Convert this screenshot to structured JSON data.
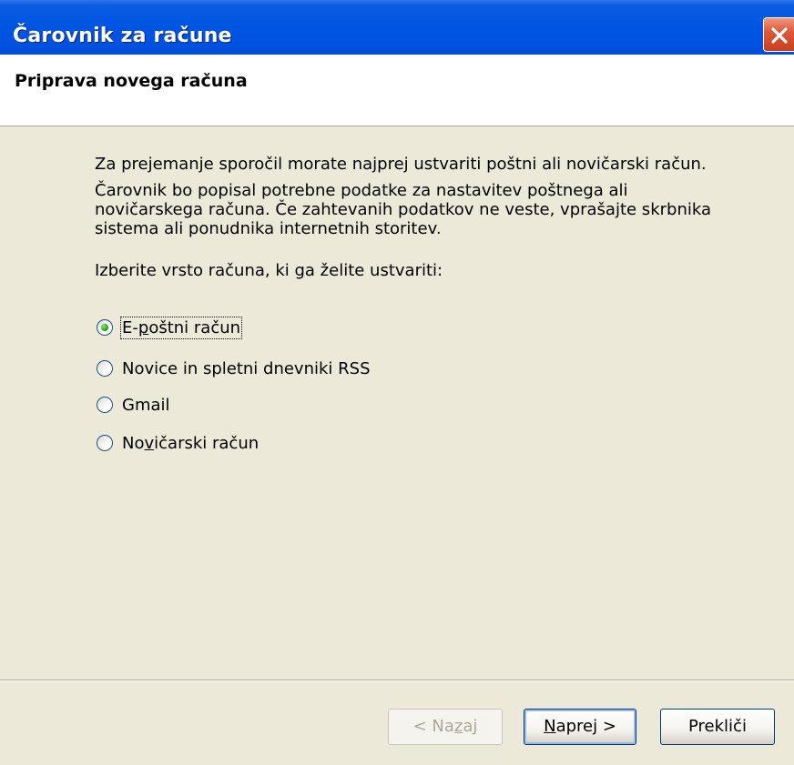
{
  "window": {
    "title": "Čarovnik za račune",
    "close_icon": "close-icon"
  },
  "header": {
    "heading": "Priprava novega računa"
  },
  "body": {
    "para1": "Za prejemanje sporočil morate najprej ustvariti poštni ali novičarski račun.",
    "para2_line1": "Čarovnik bo popisal potrebne podatke za nastavitev poštnega ali",
    "para2_line2": "novičarskega računa. Če zahtevanih podatkov ne veste, vprašajte skrbnika",
    "para2_line3": "sistema ali ponudnika internetnih storitev.",
    "para3": "Izberite vrsto računa, ki ga želite ustvariti:"
  },
  "account_types": [
    {
      "pre": "E-",
      "u": "p",
      "post": "oštni račun",
      "checked": true
    },
    {
      "pre": "Novice in spletni dnevniki RSS",
      "u": "",
      "post": "",
      "checked": false
    },
    {
      "pre": "Gmail",
      "u": "",
      "post": "",
      "checked": false
    },
    {
      "pre": "No",
      "u": "v",
      "post": "ičarski račun",
      "checked": false
    }
  ],
  "buttons": {
    "back_pre": "< Na",
    "back_u": "z",
    "back_post": "aj",
    "next_u": "N",
    "next_post": "aprej >",
    "cancel": "Prekliči"
  },
  "colors": {
    "titlebar": "#0054E3",
    "dialog_bg": "#ECE9D8",
    "radio_check": "#2BA81A",
    "close_button": "#E0583A"
  }
}
